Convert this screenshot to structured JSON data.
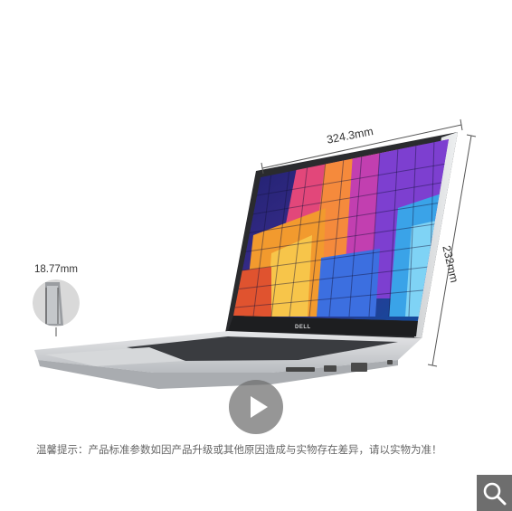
{
  "product": {
    "width_dimension": "324.3mm",
    "height_dimension": "232mm",
    "thickness_dimension": "18.77mm",
    "brand_logo": "DELL"
  },
  "notice": {
    "text": "温馨提示：产品标准参数如因产品升级或其他原因造成与实物存在差异，请以实物为准！"
  },
  "controls": {
    "play_icon": "play-icon",
    "zoom_icon": "magnifier-icon"
  },
  "colors": {
    "dimension_line": "#555555",
    "play_overlay": "#6e6e6e",
    "zoom_button": "#6e6e6e",
    "notice_text": "#666666"
  }
}
